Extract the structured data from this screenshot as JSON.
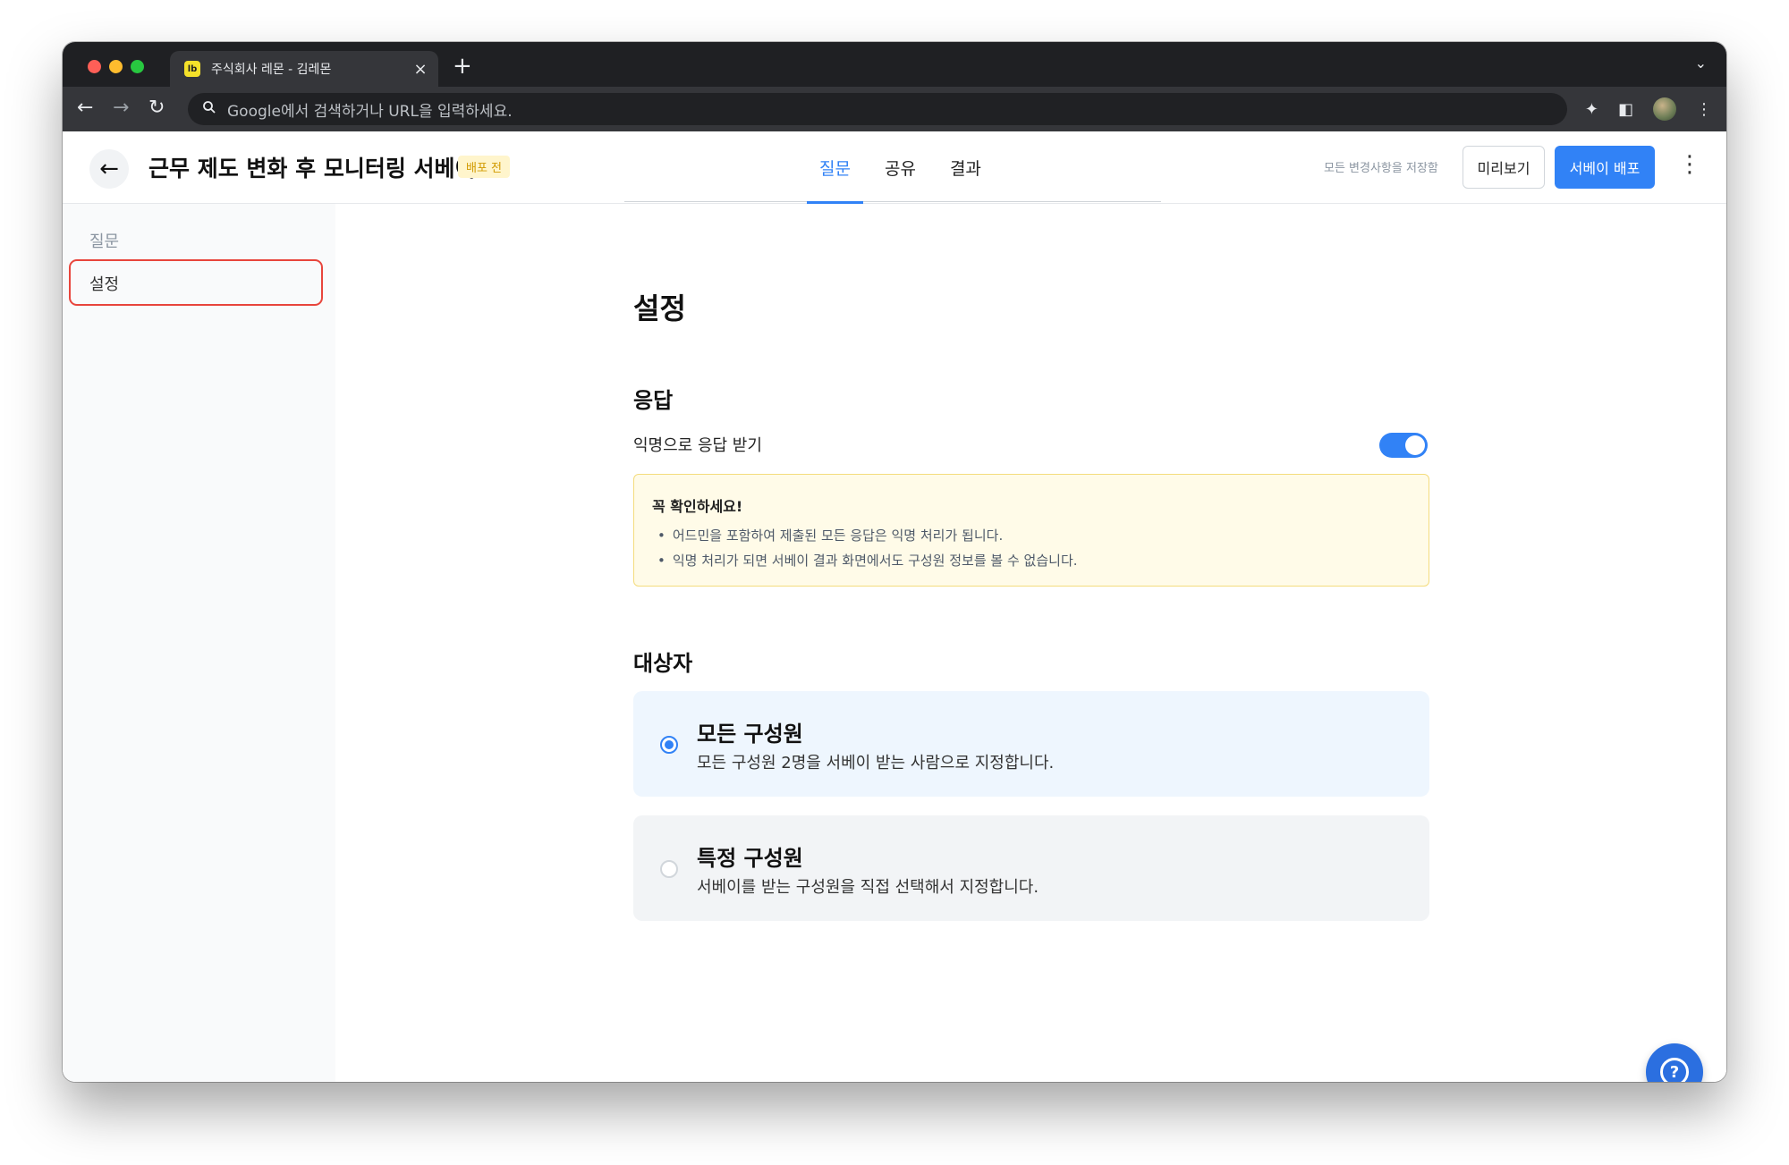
{
  "browser": {
    "tab_title": "주식회사 레몬 - 김레몬",
    "favicon_text": "lb",
    "address_placeholder": "Google에서 검색하거나 URL을 입력하세요."
  },
  "header": {
    "survey_title": "근무 제도 변화 후 모니터링 서베이",
    "status_badge": "배포 전",
    "tabs": [
      {
        "label": "질문",
        "active": true
      },
      {
        "label": "공유",
        "active": false
      },
      {
        "label": "결과",
        "active": false
      }
    ],
    "save_note": "모든 변경사항을 저장함",
    "preview_label": "미리보기",
    "deploy_label": "서베이 배포"
  },
  "sidebar": {
    "items": [
      {
        "label": "질문"
      },
      {
        "label": "설정"
      }
    ]
  },
  "main": {
    "title": "설정",
    "response": {
      "heading": "응답",
      "anonymous_label": "익명으로 응답 받기",
      "anonymous_enabled": true,
      "notice": {
        "title": "꼭 확인하세요!",
        "items": [
          "어드민을 포함하여 제출된 모든 응답은 익명 처리가 됩니다.",
          "익명 처리가 되면 서베이 결과 화면에서도 구성원 정보를 볼 수 없습니다."
        ]
      }
    },
    "target": {
      "heading": "대상자",
      "options": [
        {
          "title": "모든 구성원",
          "desc": "모든 구성원 2명을 서베이 받는 사람으로 지정합니다.",
          "selected": true
        },
        {
          "title": "특정 구성원",
          "desc": "서베이를 받는 구성원을 직접 선택해서 지정합니다.",
          "selected": false
        }
      ]
    }
  },
  "colors": {
    "accent": "#3182f6",
    "highlight": "#e8453c",
    "notice_bg": "#fffbe8"
  }
}
